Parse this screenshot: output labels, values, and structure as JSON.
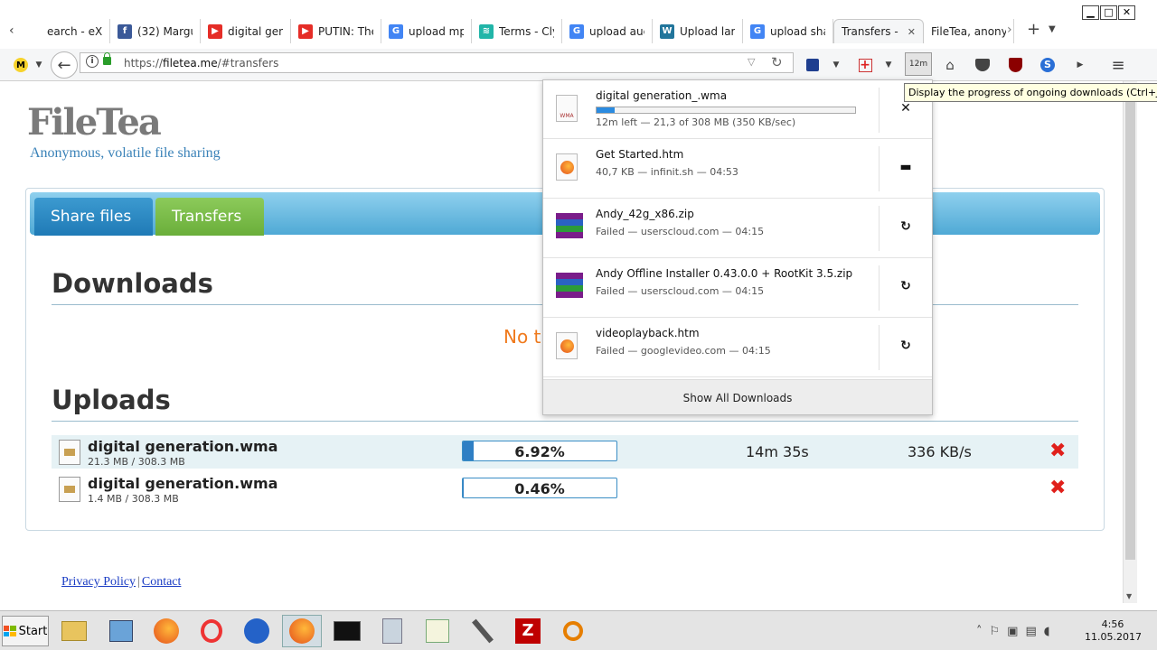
{
  "browser": {
    "window_controls": {
      "minimize": "▁",
      "maximize": "□",
      "close": "✕"
    },
    "tabs": [
      {
        "label": "earch - eX",
        "icon": "search-icon",
        "icon_char": ""
      },
      {
        "label": "(32) Margu",
        "icon": "facebook-icon",
        "icon_char": "f",
        "color": "#3b5998"
      },
      {
        "label": "digital gene",
        "icon": "youtube-icon",
        "icon_char": "▶",
        "color": "#e52d27"
      },
      {
        "label": "PUTIN: The",
        "icon": "youtube-icon",
        "icon_char": "▶",
        "color": "#e52d27"
      },
      {
        "label": "upload mp",
        "icon": "google-icon",
        "icon_char": "G",
        "color": "#4285f4"
      },
      {
        "label": "Terms - Cly",
        "icon": "clyp-icon",
        "icon_char": "≋",
        "color": "#21b5a8"
      },
      {
        "label": "upload auc",
        "icon": "google-icon",
        "icon_char": "G",
        "color": "#4285f4"
      },
      {
        "label": "Upload larg",
        "icon": "wordpress-icon",
        "icon_char": "W",
        "color": "#21759b"
      },
      {
        "label": "upload sha",
        "icon": "google-icon",
        "icon_char": "G",
        "color": "#4285f4"
      },
      {
        "label": "Transfers - F",
        "icon": "",
        "active": true
      },
      {
        "label": "FileTea, anonyr",
        "icon": ""
      }
    ],
    "url": {
      "prefix": "https://",
      "host": "filetea.me",
      "path": "/#transfers"
    },
    "download_button_label": "12m",
    "tooltip": "Display the progress of ongoing downloads (Ctrl+J)"
  },
  "page": {
    "logo": "FileTea",
    "tagline": "Anonymous, volatile file sharing",
    "tabs": {
      "share": "Share files",
      "transfers": "Transfers"
    },
    "downloads_heading": "Downloads",
    "no_transfers": "No t",
    "uploads_heading": "Uploads",
    "uploads": [
      {
        "name": "digital generation.wma",
        "size": "21.3 MB / 308.3 MB",
        "percent_text": "6.92%",
        "progress": 0.0692,
        "time_left": "14m 35s",
        "speed": "336 KB/s"
      },
      {
        "name": "digital generation.wma",
        "size": "1.4 MB / 308.3 MB",
        "percent_text": "0.46%",
        "progress": 0.0046,
        "time_left": "",
        "speed": ""
      }
    ],
    "footer": {
      "privacy": "Privacy Policy",
      "separator": "|",
      "contact": "Contact"
    }
  },
  "downloads_panel": {
    "items": [
      {
        "name": "digital generation_.wma",
        "status": "12m left — 21,3 of 308 MB (350 KB/sec)",
        "progress": 0.069,
        "type": "wma",
        "action": "cancel-icon",
        "action_char": "✕"
      },
      {
        "name": "Get Started.htm",
        "status": "40,7 KB — infinit.sh — 04:53",
        "type": "htm",
        "action": "folder-icon",
        "action_char": "▬"
      },
      {
        "name": "Andy_42g_x86.zip",
        "status": "Failed — userscloud.com — 04:15",
        "type": "zip",
        "action": "retry-icon",
        "action_char": "↻"
      },
      {
        "name": "Andy Offline Installer 0.43.0.0 + RootKit 3.5.zip",
        "status": "Failed — userscloud.com — 04:15",
        "type": "zip",
        "action": "retry-icon",
        "action_char": "↻"
      },
      {
        "name": "videoplayback.htm",
        "status": "Failed — googlevideo.com — 04:15",
        "type": "htm",
        "action": "retry-icon",
        "action_char": "↻"
      }
    ],
    "show_all": "Show All Downloads",
    "wma_icon_label": "WMA"
  },
  "taskbar": {
    "start": "Start",
    "clock_time": "4:56",
    "clock_date": "11.05.2017"
  },
  "colors": {
    "accent_blue": "#2f7fc4",
    "tab_green": "#6aae3a",
    "warning_orange": "#f07a1d",
    "cancel_red": "#e0201b"
  }
}
